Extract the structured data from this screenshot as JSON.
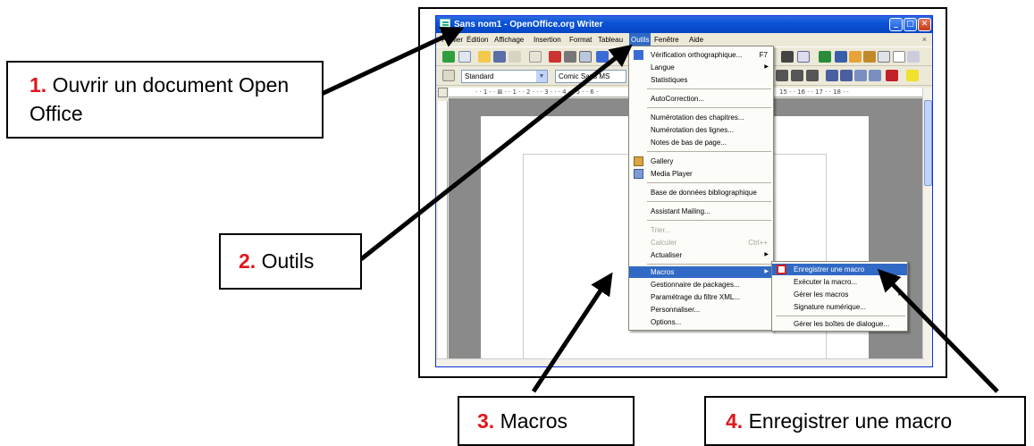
{
  "window": {
    "title": "Sans nom1 - OpenOffice.org Writer",
    "controls": {
      "minimize": "_",
      "maximize": "□",
      "close": "✕"
    }
  },
  "menubar": {
    "items": [
      "Fichier",
      "Édition",
      "Affichage",
      "Insertion",
      "Format",
      "Tableau",
      "Outils",
      "Fenêtre",
      "Aide"
    ],
    "active": "Outils",
    "close_document": "×"
  },
  "formatting": {
    "style": "Standard",
    "font": "Comic Sans MS"
  },
  "ruler_text": "· · 1 · · ⊠ · · 1 · · 2 · · · 3 · · · 4 · · 5 · · 6 ·",
  "ruler_text_right": "15 · · 16 · · 17 · · 18 · ·",
  "outils_menu": {
    "items": [
      {
        "label": "Vérification orthographique...",
        "shortcut": "F7",
        "icon": "spellcheck-icon"
      },
      {
        "label": "Langue",
        "submenu": true
      },
      {
        "label": "Statistiques"
      },
      {
        "label": "AutoCorrection..."
      },
      {
        "label": "Numérotation des chapitres..."
      },
      {
        "label": "Numérotation des lignes..."
      },
      {
        "label": "Notes de bas de page..."
      },
      {
        "label": "Gallery",
        "icon": "gallery-icon"
      },
      {
        "label": "Media Player",
        "icon": "media-player-icon"
      },
      {
        "label": "Base de données bibliographique"
      },
      {
        "label": "Assistant Mailing..."
      },
      {
        "label": "Trier...",
        "disabled": true
      },
      {
        "label": "Calculer",
        "shortcut": "Ctrl++",
        "disabled": true
      },
      {
        "label": "Actualiser",
        "submenu": true
      },
      {
        "label": "Macros",
        "submenu": true,
        "highlighted": true
      },
      {
        "label": "Gestionnaire de packages..."
      },
      {
        "label": "Paramétrage du filtre XML..."
      },
      {
        "label": "Personnaliser..."
      },
      {
        "label": "Options..."
      }
    ]
  },
  "macros_submenu": {
    "items": [
      {
        "label": "Enregistrer une macro",
        "highlighted": true,
        "icon": "record-macro-icon"
      },
      {
        "label": "Exécuter la macro..."
      },
      {
        "label": "Gérer les macros",
        "submenu": true
      },
      {
        "label": "Signature numérique..."
      },
      {
        "label": "Gérer les boîtes de dialogue..."
      }
    ]
  },
  "callouts": [
    {
      "number": "1.",
      "text": "Ouvrir un document Open Office"
    },
    {
      "number": "2.",
      "text": "Outils"
    },
    {
      "number": "3.",
      "text": "Macros"
    },
    {
      "number": "4.",
      "text": "Enregistrer une macro"
    }
  ],
  "colors": {
    "highlight": "#316ac5",
    "callout_number": "#e0161a",
    "titlebar": "#0a53d6"
  }
}
